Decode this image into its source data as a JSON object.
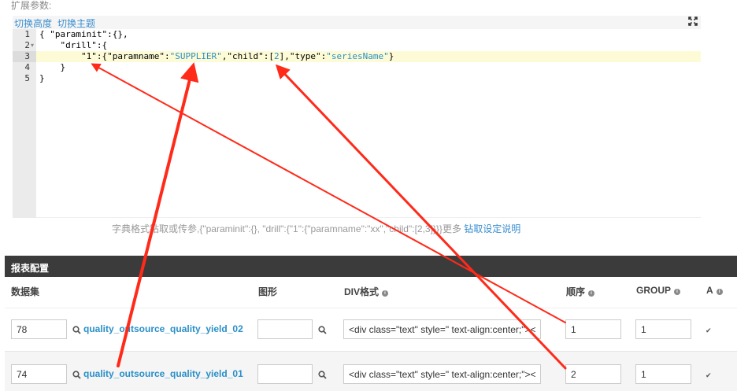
{
  "page": {
    "label": "扩展参数:"
  },
  "toolbar": {
    "toggle_height": "切换高度",
    "toggle_theme": "切换主题",
    "fullscreen_icon": "expand-icon"
  },
  "editor": {
    "line_numbers": [
      "1",
      "2",
      "3",
      "4",
      "5"
    ],
    "lines": [
      "{ \"paraminit\":{},",
      "    \"drill\":{",
      "        \"1\":{\"paramname\":\"SUPPLIER\",\"child\":[2],\"type\":\"seriesName\"}",
      "    }",
      "}"
    ]
  },
  "hint": {
    "text": "字典格式钻取或传参,{\"paraminit\":{}, \"drill\":{\"1\":{\"paramname\":\"xx\",\"child\":[2,3]}}}更多",
    "link": "钻取设定说明"
  },
  "panel": {
    "title": "报表配置"
  },
  "table": {
    "columns": {
      "dataset": "数据集",
      "chart": "图形",
      "div_format": "DIV格式",
      "order": "顺序",
      "group": "GROUP",
      "a": "A"
    },
    "rows": [
      {
        "id": "78",
        "dataset": "quality_outsource_quality_yield_02",
        "chart": "",
        "div": "<div class=\"text\" style=\" text-align:center;\"><",
        "order": "1",
        "group": "1"
      },
      {
        "id": "74",
        "dataset": "quality_outsource_quality_yield_01",
        "chart": "",
        "div": "<div class=\"text\" style=\" text-align:center;\"><",
        "order": "2",
        "group": "1"
      }
    ]
  },
  "annotation": {
    "arrow_color": "#ff2a1a"
  }
}
